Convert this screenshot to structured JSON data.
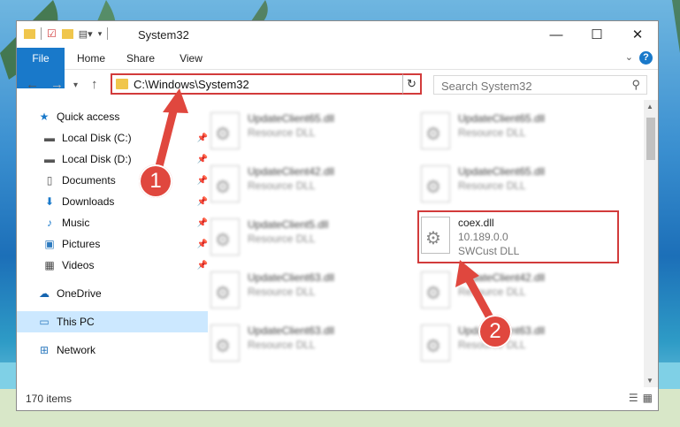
{
  "window": {
    "title": "System32",
    "controls": [
      "—",
      "☐",
      "✕"
    ]
  },
  "ribbon": {
    "tabs": [
      "File",
      "Home",
      "Share",
      "View"
    ],
    "help": "?"
  },
  "nav": {
    "address_path": "C:\\Windows\\System32",
    "search_placeholder": "Search System32"
  },
  "sidebar": {
    "items": [
      {
        "label": "Quick access",
        "icon": "star-icon"
      },
      {
        "label": "Local Disk (C:)",
        "icon": "drive-icon"
      },
      {
        "label": "Local Disk (D:)",
        "icon": "drive-icon"
      },
      {
        "label": "Documents",
        "icon": "document-icon"
      },
      {
        "label": "Downloads",
        "icon": "download-icon"
      },
      {
        "label": "Music",
        "icon": "music-icon"
      },
      {
        "label": "Pictures",
        "icon": "pictures-icon"
      },
      {
        "label": "Videos",
        "icon": "videos-icon"
      },
      {
        "label": "OneDrive",
        "icon": "cloud-icon"
      },
      {
        "label": "This PC",
        "icon": "computer-icon"
      },
      {
        "label": "Network",
        "icon": "network-icon"
      }
    ]
  },
  "files": [
    {
      "name": "UpdateClient65.dll",
      "type": "Resource DLL"
    },
    {
      "name": "UpdateClient65.dll",
      "type": "Resource DLL"
    },
    {
      "name": "UpdateClient42.dll",
      "type": "Resource DLL"
    },
    {
      "name": "UpdateClient65.dll",
      "type": "Resource DLL"
    },
    {
      "name": "UpdateClient5.dll",
      "type": "Resource DLL"
    },
    {
      "name": "coex.dll",
      "version": "10.189.0.0",
      "type": "SWCust DLL"
    },
    {
      "name": "UpdateClient63.dll",
      "type": "Resource DLL"
    },
    {
      "name": "UpdateClient42.dll",
      "type": "Resource DLL"
    },
    {
      "name": "UpdateClient63.dll",
      "type": "Resource DLL"
    },
    {
      "name": "UpdateClient63.dll",
      "type": "Resource DLL"
    }
  ],
  "status": {
    "item_count": "170 items"
  },
  "callouts": [
    "1",
    "2"
  ],
  "colors": {
    "accent": "#1979ca",
    "annotation": "#d23b3b",
    "callout": "#e0473e"
  }
}
